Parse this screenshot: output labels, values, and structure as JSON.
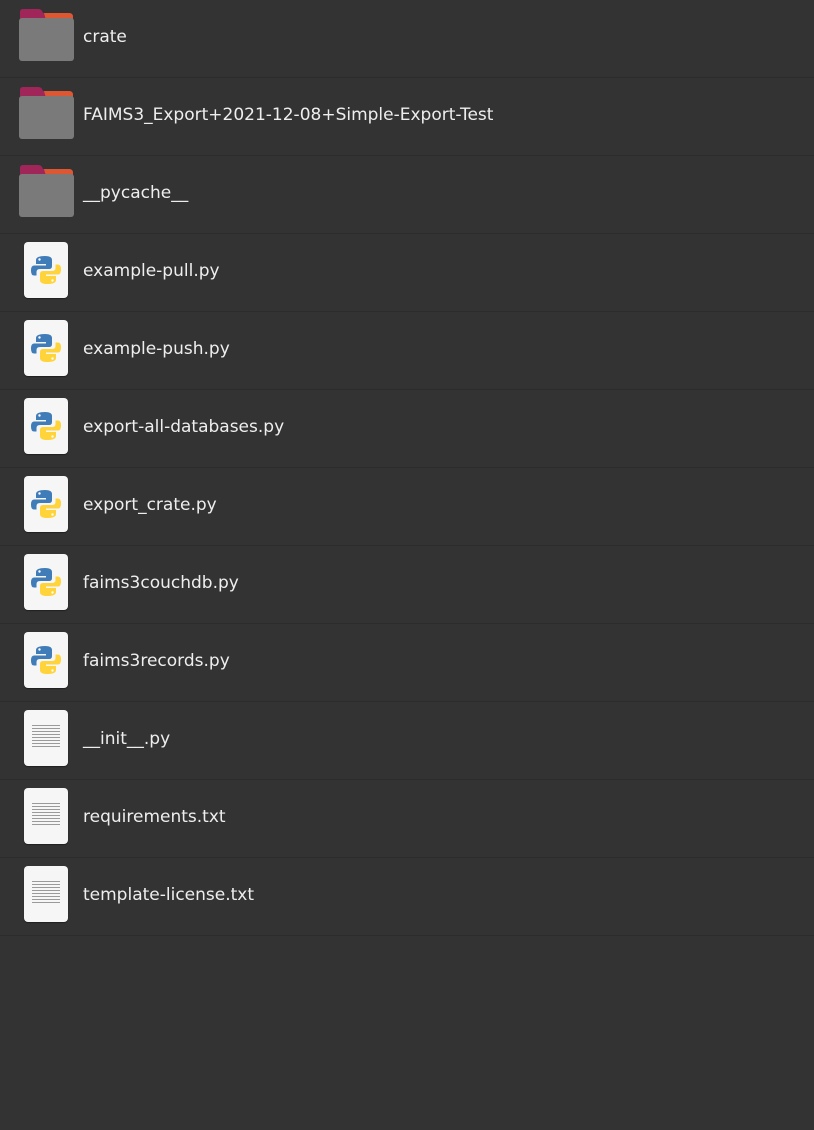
{
  "files": [
    {
      "name": "crate",
      "icon": "folder-icon"
    },
    {
      "name": "FAIMS3_Export+2021-12-08+Simple-Export-Test",
      "icon": "folder-icon"
    },
    {
      "name": "__pycache__",
      "icon": "folder-icon"
    },
    {
      "name": "example-pull.py",
      "icon": "python-file-icon"
    },
    {
      "name": "example-push.py",
      "icon": "python-file-icon"
    },
    {
      "name": "export-all-databases.py",
      "icon": "python-file-icon"
    },
    {
      "name": "export_crate.py",
      "icon": "python-file-icon"
    },
    {
      "name": "faims3couchdb.py",
      "icon": "python-file-icon"
    },
    {
      "name": "faims3records.py",
      "icon": "python-file-icon"
    },
    {
      "name": "__init__.py",
      "icon": "text-file-icon"
    },
    {
      "name": "requirements.txt",
      "icon": "text-file-icon"
    },
    {
      "name": "template-license.txt",
      "icon": "text-file-icon"
    }
  ],
  "colors": {
    "background": "#333333",
    "folder_body": "#7a7a7a",
    "folder_tab": "#a0265a",
    "folder_accent": "#e8602c",
    "python_blue": "#3f7cb8",
    "python_yellow": "#ffd43b",
    "text": "#eeeeee"
  }
}
